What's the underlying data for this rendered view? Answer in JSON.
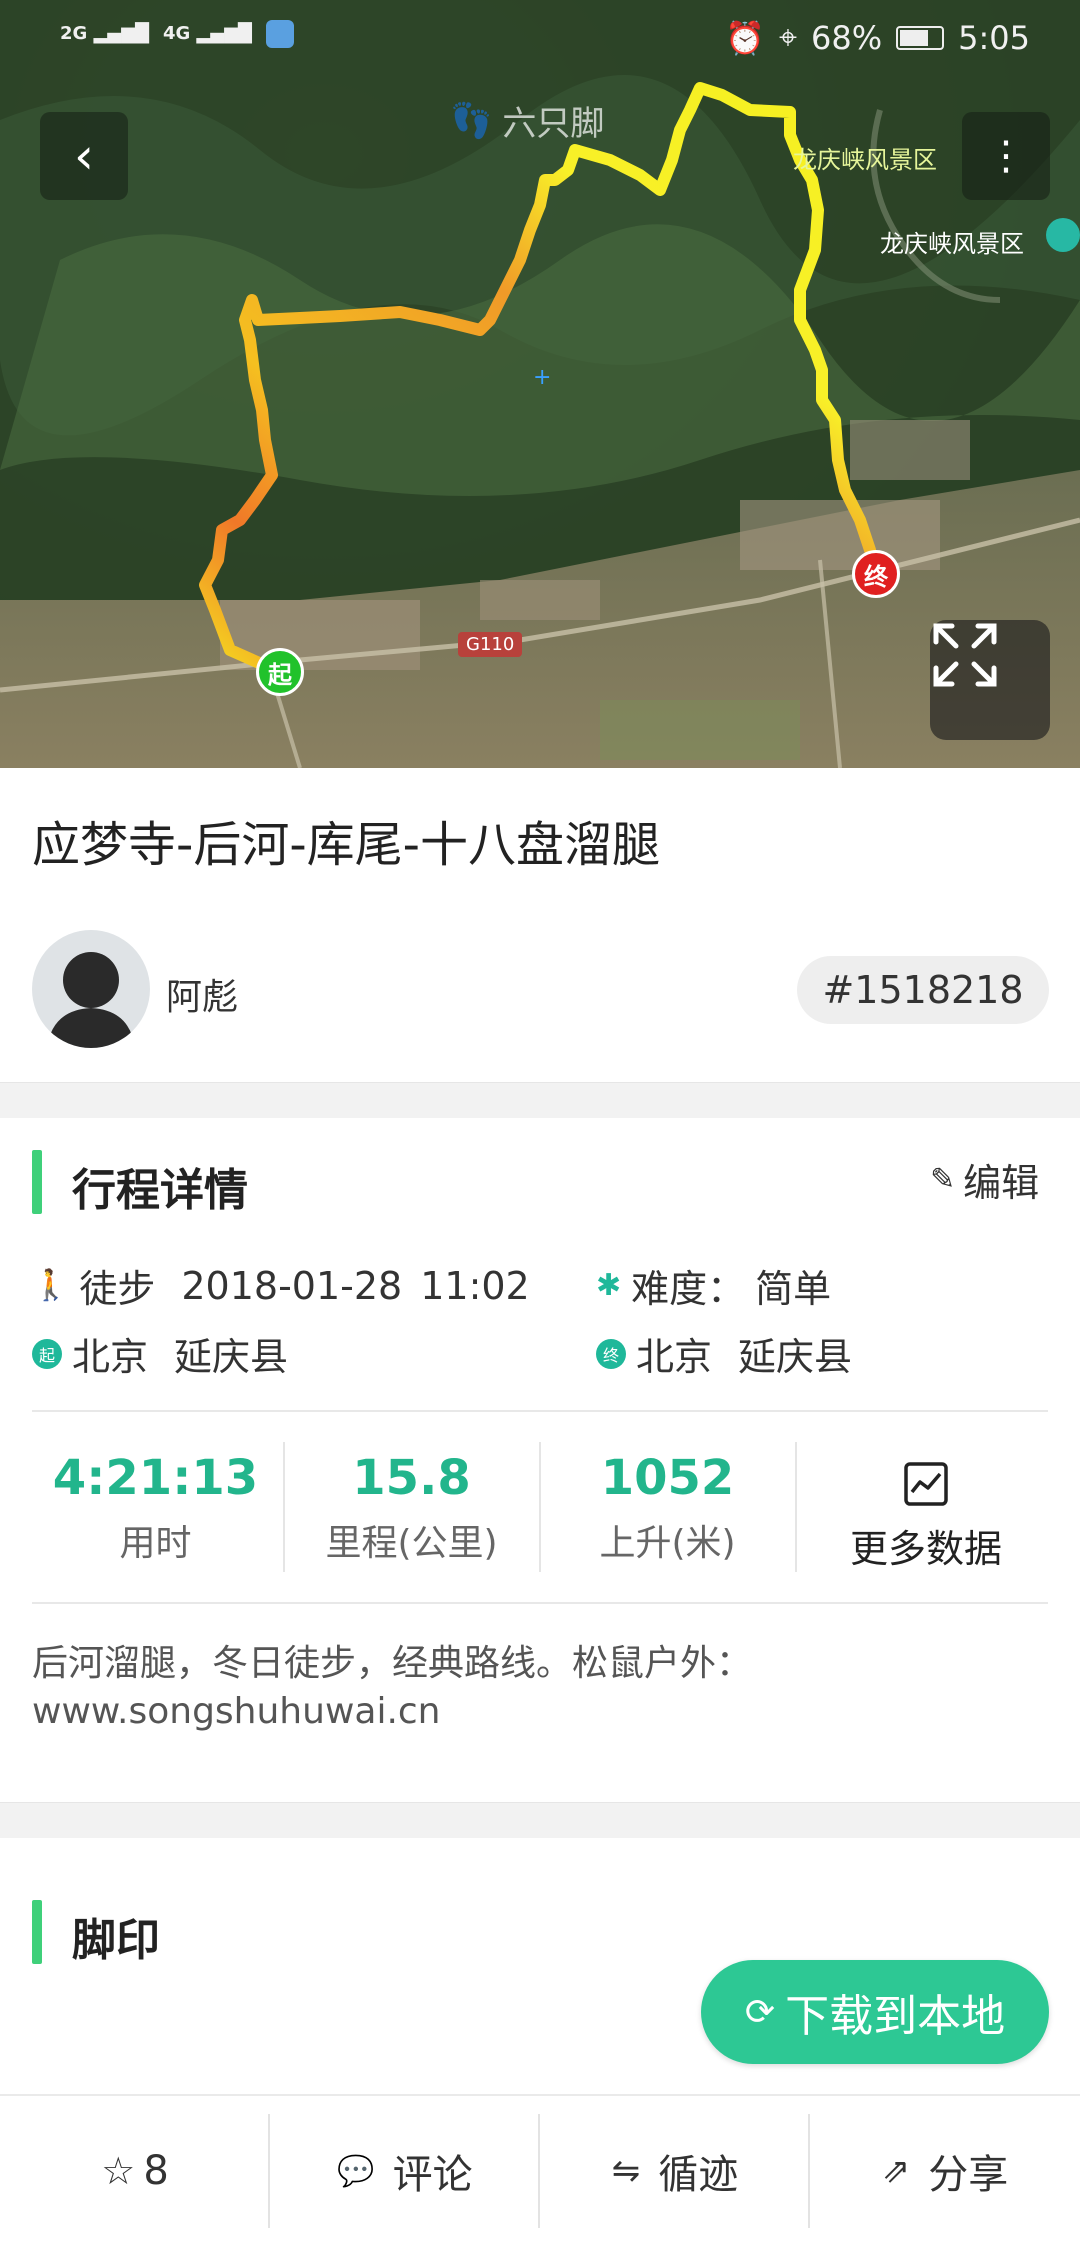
{
  "status_bar": {
    "signal_left": "2G",
    "signal_right": "4G",
    "battery": "68%",
    "time": "5:05"
  },
  "map": {
    "watermark": "六只脚",
    "place_label_1": "龙庆峡风景区",
    "place_label_2": "龙庆峡风景区",
    "road_label": "G110",
    "start_marker": "起",
    "end_marker": "终"
  },
  "trip": {
    "title": "应梦寺-后河-库尾-十八盘溜腿",
    "author": "阿彪",
    "id": "#1518218"
  },
  "details": {
    "section_title": "行程详情",
    "edit_label": "编辑",
    "type": "徒步",
    "date": "2018-01-28",
    "time": "11:02",
    "difficulty_label": "难度：",
    "difficulty_value": "简单",
    "start_province": "北京",
    "start_county": "延庆县",
    "end_province": "北京",
    "end_county": "延庆县",
    "start_badge": "起",
    "end_badge": "终"
  },
  "stats": [
    {
      "value": "4:21:13",
      "label": "用时"
    },
    {
      "value": "15.8",
      "label": "里程(公里)"
    },
    {
      "value": "1052",
      "label": "上升(米)"
    }
  ],
  "more_data_label": "更多数据",
  "description_line1": "后河溜腿，冬日徒步，经典路线。松鼠户外：",
  "description_line2": "www.songshuhuwai.cn",
  "footprint": {
    "section_title": "脚印"
  },
  "download_label": "下载到本地",
  "bottom_bar": {
    "favorite_count": "8",
    "comment_label": "评论",
    "follow_label": "循迹",
    "share_label": "分享"
  },
  "colors": {
    "accent": "#2dc894",
    "stat_value": "#22b58c",
    "section_bar": "#3fd07a",
    "route_yellow": "#f5f020",
    "route_orange": "#f08a2a"
  }
}
